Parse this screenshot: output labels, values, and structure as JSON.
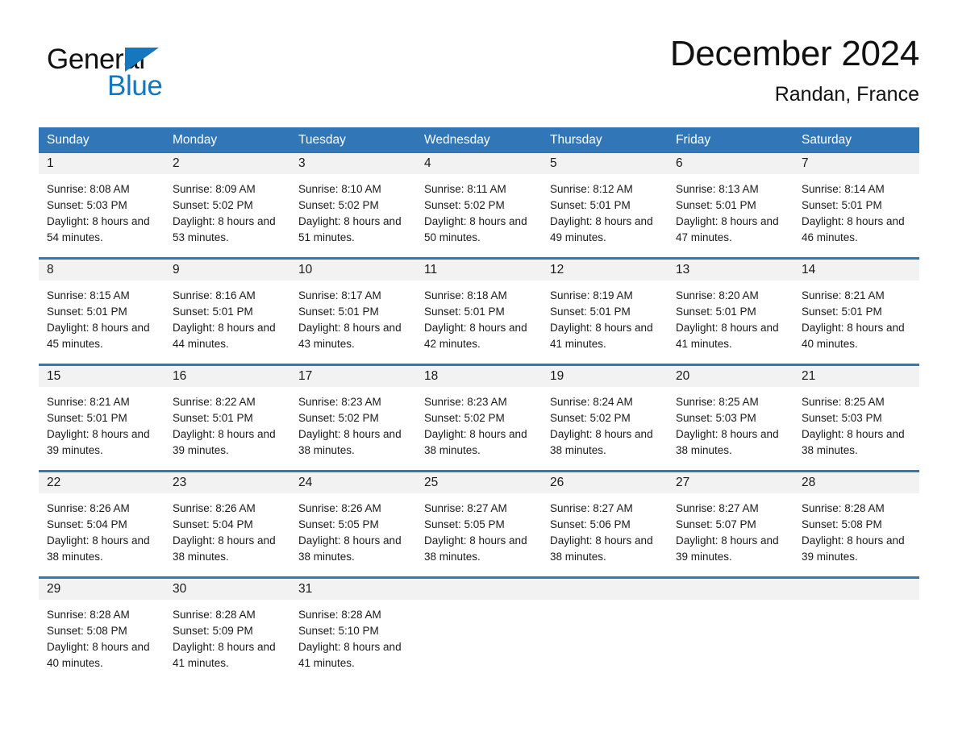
{
  "logo": {
    "text_general": "General",
    "text_blue": "Blue",
    "accent_color": "#1577bd"
  },
  "header": {
    "month_title": "December 2024",
    "location": "Randan, France"
  },
  "calendar": {
    "header_color": "#3177b8",
    "daynum_band_color": "#f2f2f2",
    "day_names": [
      "Sunday",
      "Monday",
      "Tuesday",
      "Wednesday",
      "Thursday",
      "Friday",
      "Saturday"
    ],
    "weeks": [
      [
        {
          "day": "1",
          "sunrise": "Sunrise: 8:08 AM",
          "sunset": "Sunset: 5:03 PM",
          "daylight": "Daylight: 8 hours and 54 minutes."
        },
        {
          "day": "2",
          "sunrise": "Sunrise: 8:09 AM",
          "sunset": "Sunset: 5:02 PM",
          "daylight": "Daylight: 8 hours and 53 minutes."
        },
        {
          "day": "3",
          "sunrise": "Sunrise: 8:10 AM",
          "sunset": "Sunset: 5:02 PM",
          "daylight": "Daylight: 8 hours and 51 minutes."
        },
        {
          "day": "4",
          "sunrise": "Sunrise: 8:11 AM",
          "sunset": "Sunset: 5:02 PM",
          "daylight": "Daylight: 8 hours and 50 minutes."
        },
        {
          "day": "5",
          "sunrise": "Sunrise: 8:12 AM",
          "sunset": "Sunset: 5:01 PM",
          "daylight": "Daylight: 8 hours and 49 minutes."
        },
        {
          "day": "6",
          "sunrise": "Sunrise: 8:13 AM",
          "sunset": "Sunset: 5:01 PM",
          "daylight": "Daylight: 8 hours and 47 minutes."
        },
        {
          "day": "7",
          "sunrise": "Sunrise: 8:14 AM",
          "sunset": "Sunset: 5:01 PM",
          "daylight": "Daylight: 8 hours and 46 minutes."
        }
      ],
      [
        {
          "day": "8",
          "sunrise": "Sunrise: 8:15 AM",
          "sunset": "Sunset: 5:01 PM",
          "daylight": "Daylight: 8 hours and 45 minutes."
        },
        {
          "day": "9",
          "sunrise": "Sunrise: 8:16 AM",
          "sunset": "Sunset: 5:01 PM",
          "daylight": "Daylight: 8 hours and 44 minutes."
        },
        {
          "day": "10",
          "sunrise": "Sunrise: 8:17 AM",
          "sunset": "Sunset: 5:01 PM",
          "daylight": "Daylight: 8 hours and 43 minutes."
        },
        {
          "day": "11",
          "sunrise": "Sunrise: 8:18 AM",
          "sunset": "Sunset: 5:01 PM",
          "daylight": "Daylight: 8 hours and 42 minutes."
        },
        {
          "day": "12",
          "sunrise": "Sunrise: 8:19 AM",
          "sunset": "Sunset: 5:01 PM",
          "daylight": "Daylight: 8 hours and 41 minutes."
        },
        {
          "day": "13",
          "sunrise": "Sunrise: 8:20 AM",
          "sunset": "Sunset: 5:01 PM",
          "daylight": "Daylight: 8 hours and 41 minutes."
        },
        {
          "day": "14",
          "sunrise": "Sunrise: 8:21 AM",
          "sunset": "Sunset: 5:01 PM",
          "daylight": "Daylight: 8 hours and 40 minutes."
        }
      ],
      [
        {
          "day": "15",
          "sunrise": "Sunrise: 8:21 AM",
          "sunset": "Sunset: 5:01 PM",
          "daylight": "Daylight: 8 hours and 39 minutes."
        },
        {
          "day": "16",
          "sunrise": "Sunrise: 8:22 AM",
          "sunset": "Sunset: 5:01 PM",
          "daylight": "Daylight: 8 hours and 39 minutes."
        },
        {
          "day": "17",
          "sunrise": "Sunrise: 8:23 AM",
          "sunset": "Sunset: 5:02 PM",
          "daylight": "Daylight: 8 hours and 38 minutes."
        },
        {
          "day": "18",
          "sunrise": "Sunrise: 8:23 AM",
          "sunset": "Sunset: 5:02 PM",
          "daylight": "Daylight: 8 hours and 38 minutes."
        },
        {
          "day": "19",
          "sunrise": "Sunrise: 8:24 AM",
          "sunset": "Sunset: 5:02 PM",
          "daylight": "Daylight: 8 hours and 38 minutes."
        },
        {
          "day": "20",
          "sunrise": "Sunrise: 8:25 AM",
          "sunset": "Sunset: 5:03 PM",
          "daylight": "Daylight: 8 hours and 38 minutes."
        },
        {
          "day": "21",
          "sunrise": "Sunrise: 8:25 AM",
          "sunset": "Sunset: 5:03 PM",
          "daylight": "Daylight: 8 hours and 38 minutes."
        }
      ],
      [
        {
          "day": "22",
          "sunrise": "Sunrise: 8:26 AM",
          "sunset": "Sunset: 5:04 PM",
          "daylight": "Daylight: 8 hours and 38 minutes."
        },
        {
          "day": "23",
          "sunrise": "Sunrise: 8:26 AM",
          "sunset": "Sunset: 5:04 PM",
          "daylight": "Daylight: 8 hours and 38 minutes."
        },
        {
          "day": "24",
          "sunrise": "Sunrise: 8:26 AM",
          "sunset": "Sunset: 5:05 PM",
          "daylight": "Daylight: 8 hours and 38 minutes."
        },
        {
          "day": "25",
          "sunrise": "Sunrise: 8:27 AM",
          "sunset": "Sunset: 5:05 PM",
          "daylight": "Daylight: 8 hours and 38 minutes."
        },
        {
          "day": "26",
          "sunrise": "Sunrise: 8:27 AM",
          "sunset": "Sunset: 5:06 PM",
          "daylight": "Daylight: 8 hours and 38 minutes."
        },
        {
          "day": "27",
          "sunrise": "Sunrise: 8:27 AM",
          "sunset": "Sunset: 5:07 PM",
          "daylight": "Daylight: 8 hours and 39 minutes."
        },
        {
          "day": "28",
          "sunrise": "Sunrise: 8:28 AM",
          "sunset": "Sunset: 5:08 PM",
          "daylight": "Daylight: 8 hours and 39 minutes."
        }
      ],
      [
        {
          "day": "29",
          "sunrise": "Sunrise: 8:28 AM",
          "sunset": "Sunset: 5:08 PM",
          "daylight": "Daylight: 8 hours and 40 minutes."
        },
        {
          "day": "30",
          "sunrise": "Sunrise: 8:28 AM",
          "sunset": "Sunset: 5:09 PM",
          "daylight": "Daylight: 8 hours and 41 minutes."
        },
        {
          "day": "31",
          "sunrise": "Sunrise: 8:28 AM",
          "sunset": "Sunset: 5:10 PM",
          "daylight": "Daylight: 8 hours and 41 minutes."
        },
        {
          "day": "",
          "sunrise": "",
          "sunset": "",
          "daylight": ""
        },
        {
          "day": "",
          "sunrise": "",
          "sunset": "",
          "daylight": ""
        },
        {
          "day": "",
          "sunrise": "",
          "sunset": "",
          "daylight": ""
        },
        {
          "day": "",
          "sunrise": "",
          "sunset": "",
          "daylight": ""
        }
      ]
    ]
  }
}
